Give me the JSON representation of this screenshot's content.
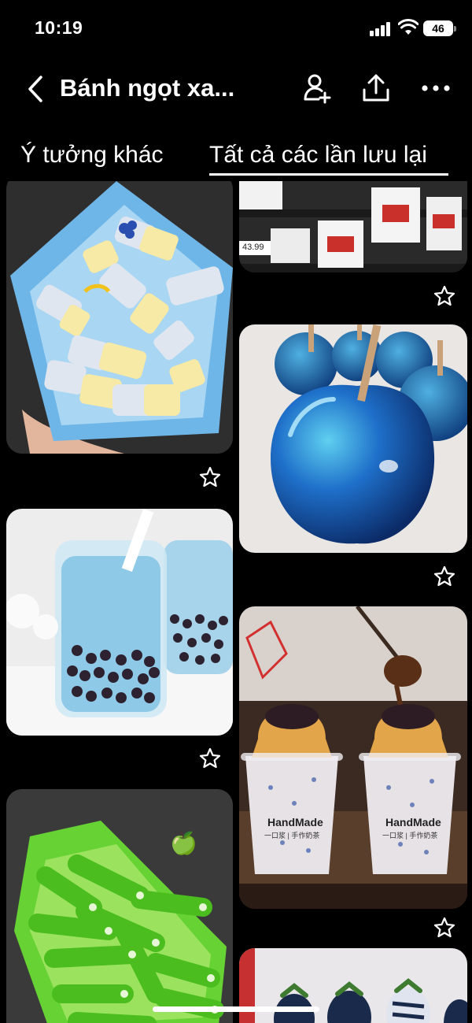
{
  "status_bar": {
    "time": "10:19",
    "battery": "46"
  },
  "header": {
    "title": "Bánh ngọt xa...",
    "icons": [
      "back-icon",
      "add-user-icon",
      "share-icon",
      "more-icon"
    ]
  },
  "tabs": [
    {
      "label": "Ý tưởng khác",
      "active": false
    },
    {
      "label": "Tất cả các lần lưu lại",
      "active": true
    }
  ],
  "pins": [
    {
      "name": "blueberry-banana-candy",
      "star": "star-icon"
    },
    {
      "name": "nutella-jars-shelf",
      "star": "star-icon",
      "price_tag": "43.99"
    },
    {
      "name": "blue-candy-apples",
      "star": "star-icon"
    },
    {
      "name": "blue-bubble-tea",
      "star": "star-icon"
    },
    {
      "name": "handmade-pudding-milk-tea",
      "star": "star-icon",
      "cup_label": "HandMade",
      "cup_sub": "一口浆 | 手作奶茶"
    },
    {
      "name": "green-apple-licorice",
      "emoji": "🍏"
    },
    {
      "name": "chocolate-strawberries"
    }
  ],
  "colors": {
    "background": "#000000",
    "text": "#ffffff",
    "accent_blue": "#2a6fd6",
    "accent_green": "#5fd42a"
  }
}
